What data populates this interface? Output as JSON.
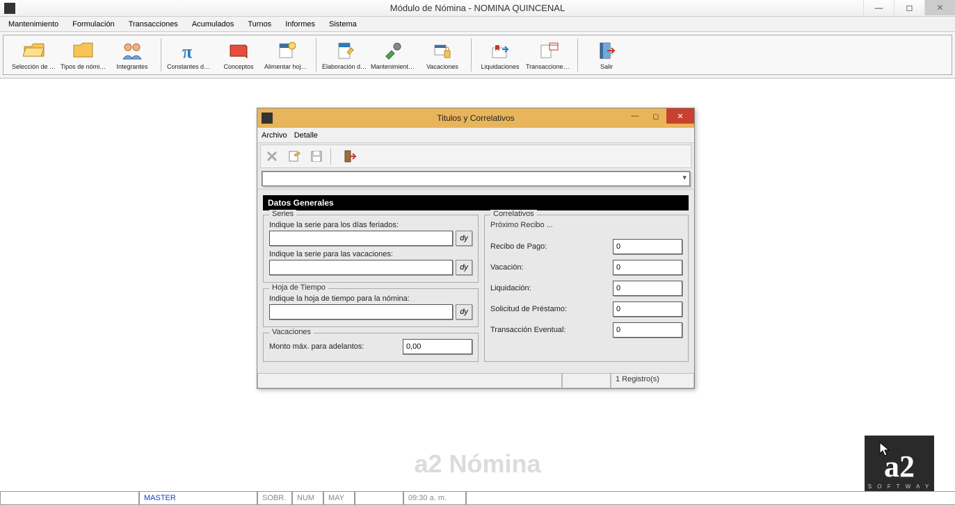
{
  "main": {
    "title": "Módulo de Nómina - NOMINA QUINCENAL",
    "menu": [
      "Mantenimiento",
      "Formulación",
      "Transacciones",
      "Acumulados",
      "Turnos",
      "Informes",
      "Sistema"
    ]
  },
  "toolbar": {
    "groups": [
      [
        {
          "label": "Selección de nó..."
        },
        {
          "label": "Tipos de nómina"
        },
        {
          "label": "Integrantes"
        }
      ],
      [
        {
          "label": "Constantes de n..."
        },
        {
          "label": "Conceptos"
        },
        {
          "label": "Alimentar hoja ..."
        }
      ],
      [
        {
          "label": "Elaboración de ..."
        },
        {
          "label": "Mantenimiento d..."
        },
        {
          "label": "Vacaciones"
        }
      ],
      [
        {
          "label": "Liquidaciones"
        },
        {
          "label": "Transacciones e..."
        }
      ],
      [
        {
          "label": "Salir"
        }
      ]
    ]
  },
  "dialog": {
    "title": "Titulos y Correlativos",
    "menu": [
      "Archivo",
      "Detalle"
    ],
    "section_header": "Datos Generales",
    "series": {
      "legend": "Series",
      "label_feriados": "Indique la serie para los días feriados:",
      "value_feriados": "",
      "label_vacaciones": "Indique la serie para las vacaciones:",
      "value_vacaciones": ""
    },
    "hoja": {
      "legend": "Hoja de Tiempo",
      "label": "Indique la hoja de tiempo para la nómina:",
      "value": ""
    },
    "vacaciones": {
      "legend": "Vacaciones",
      "label": "Monto máx. para adelantos:",
      "value": "0,00"
    },
    "correlativos": {
      "legend": "Correlativos",
      "subheader": "Próximo Recibo ...",
      "rows": [
        {
          "label": "Recibo de Pago:",
          "value": "0"
        },
        {
          "label": "Vacación:",
          "value": "0"
        },
        {
          "label": "Liquidación:",
          "value": "0"
        },
        {
          "label": "Solicitud de Préstamo:",
          "value": "0"
        },
        {
          "label": "Transacción Eventual:",
          "value": "0"
        }
      ]
    },
    "status_records": "1 Registro(s)"
  },
  "watermark": "a2 Nómina",
  "logo": {
    "brand": "a2",
    "sub": "S O F T W A Y"
  },
  "statusbar": {
    "user": "MASTER",
    "flags": [
      "SOBR.",
      "NUM",
      "MAY"
    ],
    "time": "09:30 a. m."
  }
}
